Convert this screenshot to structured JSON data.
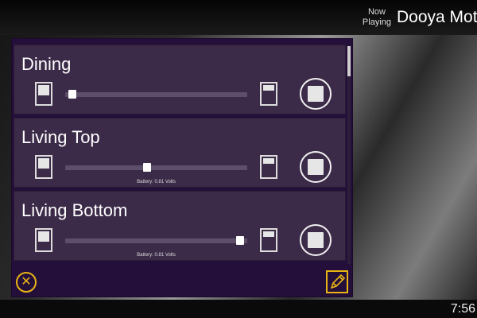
{
  "header": {
    "now_playing_line1": "Now",
    "now_playing_line2": "Playing",
    "title": "Dooya Motor"
  },
  "shades": [
    {
      "name": "Dining",
      "position": 0.04,
      "battery": ""
    },
    {
      "name": "Living Top",
      "position": 0.45,
      "battery": "Battery: 0.81 Volts"
    },
    {
      "name": "Living Bottom",
      "position": 0.96,
      "battery": "Battery: 0.81 Volts"
    }
  ],
  "footer": {
    "close_icon": "close-circle-icon",
    "edit_icon": "pencil-icon"
  },
  "clock": "7:56",
  "colors": {
    "panel": "#240e3a",
    "card": "#3b2a48",
    "accent": "#e8b514"
  }
}
